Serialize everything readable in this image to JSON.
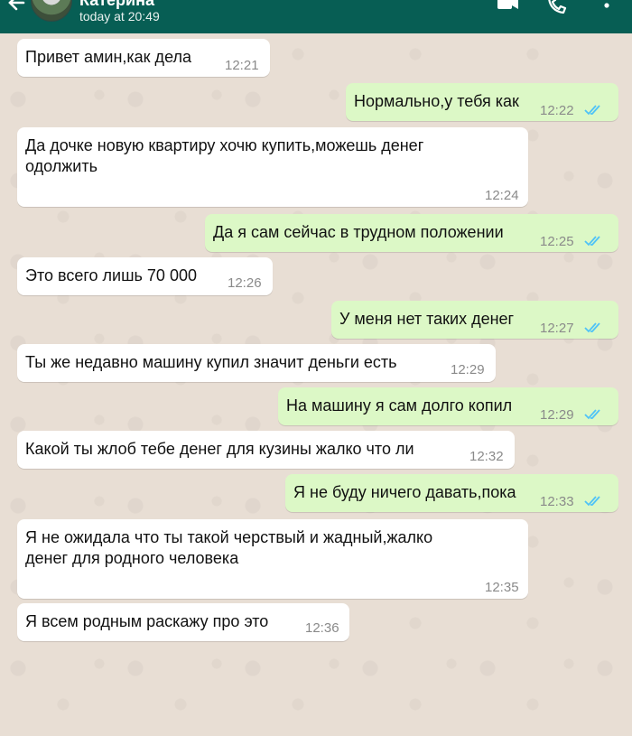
{
  "header": {
    "contact_name": "Катерина",
    "last_seen": "today at 20:49",
    "icons": [
      "back-arrow-icon",
      "avatar",
      "video-call-icon",
      "phone-icon",
      "more-vert-icon"
    ],
    "bg_color": "#075e54"
  },
  "colors": {
    "incoming_bubble": "#ffffff",
    "outgoing_bubble": "#dcf8c6",
    "read_ticks": "#4fc3f7",
    "time_text": "#8a8a8a"
  },
  "messages": [
    {
      "direction": "in",
      "text": "Привет амин,как дела",
      "time": "12:21"
    },
    {
      "direction": "out",
      "text": "Нормально,у тебя как",
      "time": "12:22",
      "status": "read"
    },
    {
      "direction": "in",
      "text": "Да дочке новую квартиру хочю купить,можешь денег\nодолжить",
      "time": "12:24"
    },
    {
      "direction": "out",
      "text": "Да я сам сейчас в трудном положении",
      "time": "12:25",
      "status": "read"
    },
    {
      "direction": "in",
      "text": "Это всего лишь 70 000",
      "time": "12:26"
    },
    {
      "direction": "out",
      "text": "У меня нет таких денег",
      "time": "12:27",
      "status": "read"
    },
    {
      "direction": "in",
      "text": "Ты же недавно машину купил значит деньги есть",
      "time": "12:29"
    },
    {
      "direction": "out",
      "text": "На машину я сам долго копил",
      "time": "12:29",
      "status": "read"
    },
    {
      "direction": "in",
      "text": "Какой ты жлоб тебе денег для кузины жалко что ли",
      "time": "12:32"
    },
    {
      "direction": "out",
      "text": "Я не буду ничего давать,пока",
      "time": "12:33",
      "status": "read"
    },
    {
      "direction": "in",
      "text": "Я не ожидала что ты такой черствый и жадный,жалко\nденег для родного человека",
      "time": "12:35"
    },
    {
      "direction": "in",
      "text": "Я всем родным раскажу про это",
      "time": "12:36"
    }
  ]
}
